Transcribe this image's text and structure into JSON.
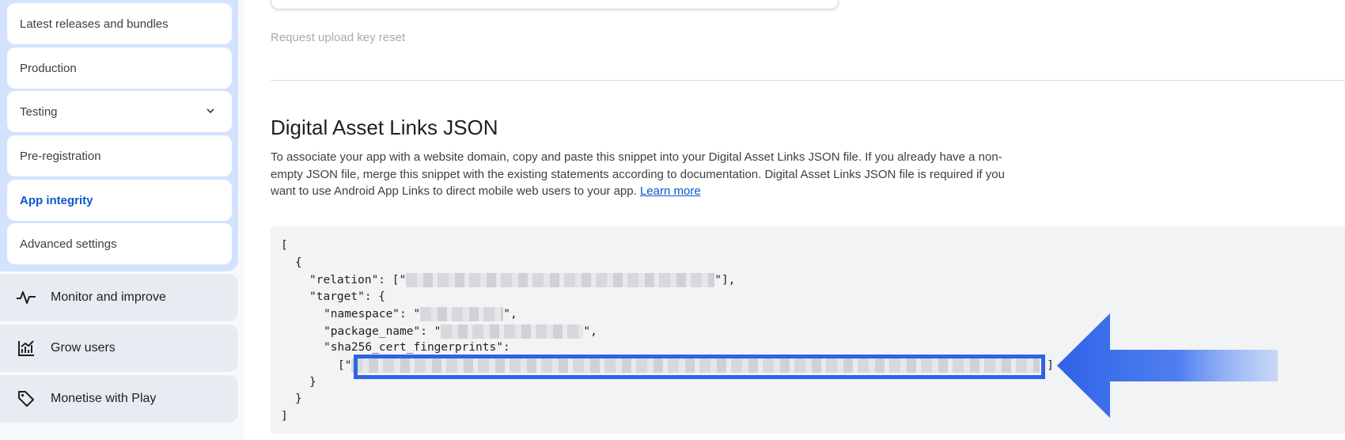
{
  "sidebar": {
    "sub_items": [
      {
        "label": "Latest releases and bundles"
      },
      {
        "label": "Production"
      },
      {
        "label": "Testing"
      },
      {
        "label": "Pre-registration"
      },
      {
        "label": "App integrity"
      },
      {
        "label": "Advanced settings"
      }
    ],
    "sections": [
      {
        "label": "Monitor and improve",
        "icon": "pulse-icon"
      },
      {
        "label": "Grow users",
        "icon": "chart-growth-icon"
      },
      {
        "label": "Monetise with Play",
        "icon": "tag-icon"
      }
    ]
  },
  "main": {
    "reset_link": "Request upload key reset",
    "heading": "Digital Asset Links JSON",
    "description": "To associate your app with a website domain, copy and paste this snippet into your Digital Asset Links JSON file. If you already have a non-empty JSON file, merge this snippet with the existing statements according to documentation. Digital Asset Links JSON file is required if you want to use Android App Links to direct mobile web users to your app.",
    "learn_more": "Learn more",
    "code": {
      "open_bracket": "[",
      "open_brace": "{",
      "relation_key": "\"relation\": [\"",
      "relation_end": "\"],",
      "target_key": "\"target\": {",
      "namespace_key": "\"namespace\": \"",
      "namespace_end": "\",",
      "package_key": "\"package_name\": \"",
      "package_end": "\",",
      "sha_key": "\"sha256_cert_fingerprints\":",
      "sha_open": "[\"",
      "sha_end": "\"]",
      "inner_close": "}",
      "outer_close": "}",
      "close_bracket": "]"
    }
  },
  "colors": {
    "accent": "#0b57d0",
    "highlight": "#2f63e6",
    "sidebar_group": "#d3e3fd"
  }
}
